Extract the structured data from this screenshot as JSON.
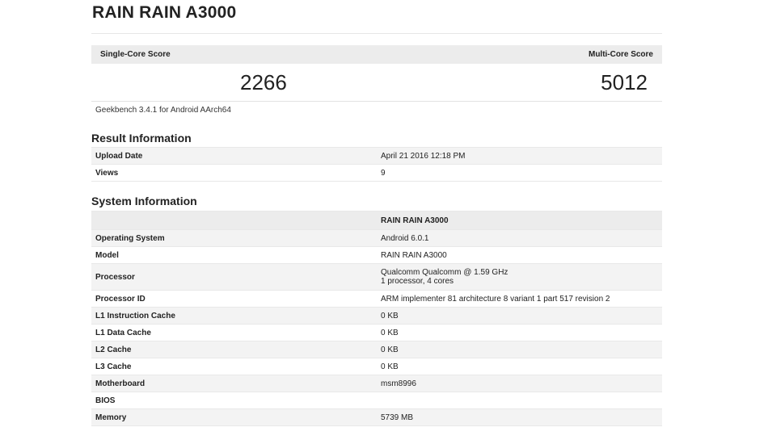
{
  "page": {
    "title": "RAIN RAIN A3000"
  },
  "scores": {
    "single_label": "Single-Core Score",
    "single_value": "2266",
    "multi_label": "Multi-Core Score",
    "multi_value": "5012"
  },
  "version": "Geekbench 3.4.1 for Android AArch64",
  "result_info": {
    "title": "Result Information",
    "rows": [
      {
        "label": "Upload Date",
        "value": "April 21 2016 12:18 PM"
      },
      {
        "label": "Views",
        "value": "9"
      }
    ]
  },
  "system_info": {
    "title": "System Information",
    "device": "RAIN RAIN A3000",
    "rows": [
      {
        "label": "Operating System",
        "value": "Android 6.0.1"
      },
      {
        "label": "Model",
        "value": "RAIN RAIN A3000"
      },
      {
        "label": "Processor",
        "value": "Qualcomm Qualcomm @ 1.59 GHz",
        "value2": "1 processor, 4 cores"
      },
      {
        "label": "Processor ID",
        "value": "ARM implementer 81 architecture 8 variant 1 part 517 revision 2"
      },
      {
        "label": "L1 Instruction Cache",
        "value": "0 KB"
      },
      {
        "label": "L1 Data Cache",
        "value": "0 KB"
      },
      {
        "label": "L2 Cache",
        "value": "0 KB"
      },
      {
        "label": "L3 Cache",
        "value": "0 KB"
      },
      {
        "label": "Motherboard",
        "value": "msm8996"
      },
      {
        "label": "BIOS",
        "value": ""
      },
      {
        "label": "Memory",
        "value": "5739 MB"
      }
    ]
  }
}
